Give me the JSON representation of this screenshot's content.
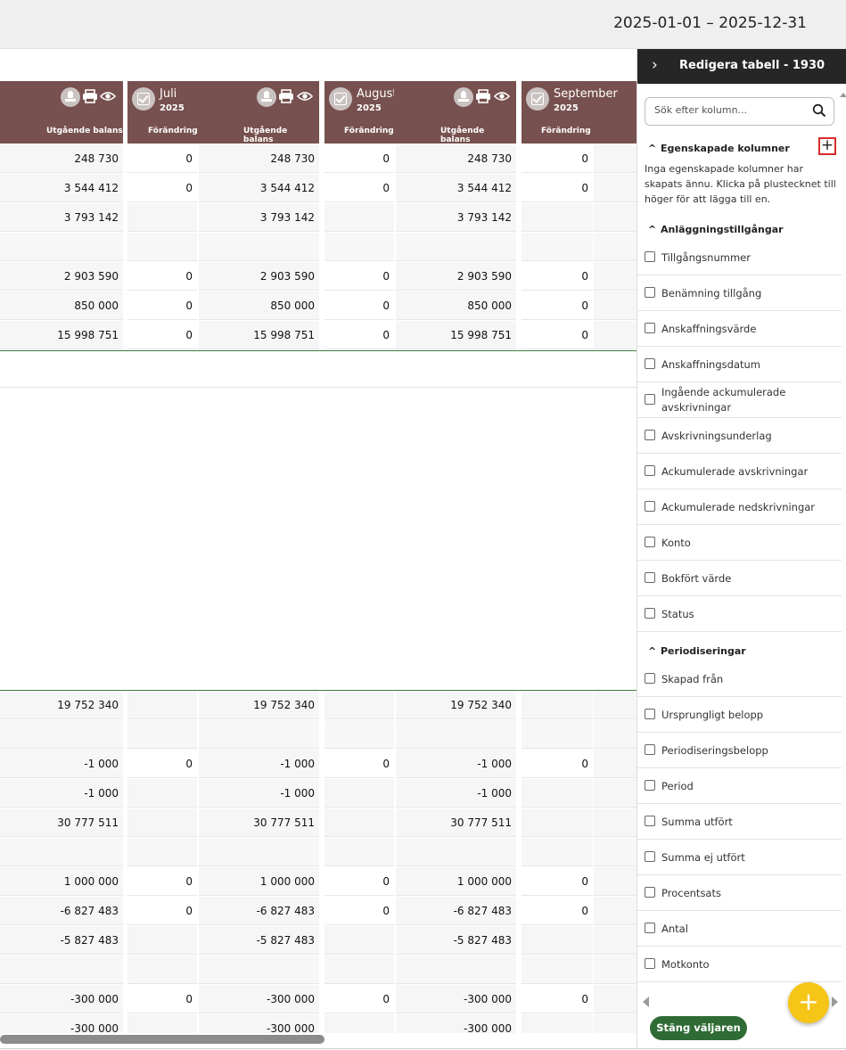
{
  "header": {
    "date_range": "2025-01-01 – 2025-12-31"
  },
  "columns": {
    "prev_sub_out": "Utgående balans",
    "months": [
      {
        "name": "Juli",
        "year": "2025",
        "sub_change": "Förändring",
        "sub_out": "Utgående balans"
      },
      {
        "name": "Augusti",
        "year": "2025",
        "sub_change": "Förändring",
        "sub_out": "Utgående balans"
      },
      {
        "name": "September",
        "year": "2025",
        "sub_change": "Förändring"
      }
    ]
  },
  "rows_top": [
    {
      "out": "248 730",
      "chg": "0"
    },
    {
      "out": "3 544 412",
      "chg": "0"
    },
    {
      "out": "3 793 142",
      "chg": ""
    },
    {
      "out": "",
      "chg": ""
    },
    {
      "out": "2 903 590",
      "chg": "0"
    },
    {
      "out": "850 000",
      "chg": "0"
    },
    {
      "out": "15 998 751",
      "chg": "0"
    }
  ],
  "rows_bottom": [
    {
      "out": "19 752 340",
      "chg": ""
    },
    {
      "out": "",
      "chg": ""
    },
    {
      "out": "-1 000",
      "chg": "0"
    },
    {
      "out": "-1 000",
      "chg": ""
    },
    {
      "out": "30 777 511",
      "chg": ""
    },
    {
      "out": "",
      "chg": ""
    },
    {
      "out": "1 000 000",
      "chg": "0"
    },
    {
      "out": "-6 827 483",
      "chg": "0"
    },
    {
      "out": "-5 827 483",
      "chg": ""
    },
    {
      "out": "",
      "chg": ""
    },
    {
      "out": "-300 000",
      "chg": "0"
    },
    {
      "out": "-300 000",
      "chg": ""
    }
  ],
  "panel": {
    "title": "Redigera tabell - 1930",
    "search_placeholder": "Sök efter kolumn...",
    "section_custom": "Egenskapade kolumner",
    "custom_info": "Inga egenskapade kolumner har skapats ännu. Klicka på plustecknet till höger för att lägga till en.",
    "section_assets": "Anläggningstillgångar",
    "assets": [
      "Tillgångsnummer",
      "Benämning tillgång",
      "Anskaffningsvärde",
      "Anskaffningsdatum",
      "Ingående ackumulerade avskrivningar",
      "Avskrivningsunderlag",
      "Ackumulerade avskrivningar",
      "Ackumulerade nedskrivningar",
      "Konto",
      "Bokfört värde",
      "Status"
    ],
    "section_accruals": "Periodiseringar",
    "accruals": [
      "Skapad från",
      "Ursprungligt belopp",
      "Periodiseringsbelopp",
      "Period",
      "Summa utfört",
      "Summa ej utfört",
      "Procentsats",
      "Antal",
      "Motkonto"
    ],
    "close_button": "Stäng väljaren"
  },
  "icons": {
    "expand_panel": "chevron-right-icon",
    "search": "search-icon",
    "add_column": "plus-icon",
    "fab": "plus-icon",
    "header_actions": [
      "stamp-icon",
      "printer-icon",
      "eye-icon"
    ]
  },
  "colors": {
    "header_bg": "#77514f",
    "panel_header_bg": "#262626",
    "close_button_bg": "#2f6b35",
    "fab_bg": "#f5c518",
    "highlight": "#d92b2b"
  }
}
